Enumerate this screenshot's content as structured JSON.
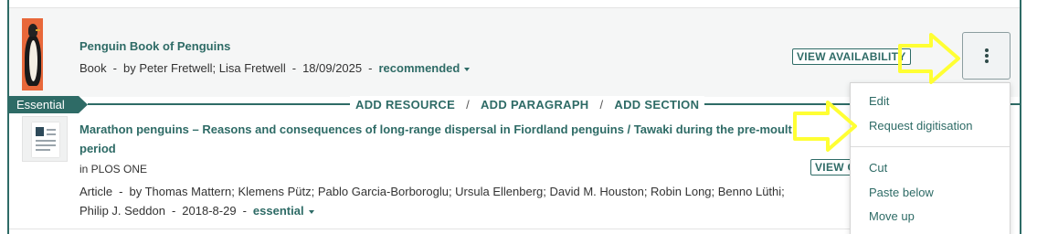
{
  "item1": {
    "title": "Penguin Book of Penguins",
    "type": "Book",
    "authors": "by Peter Fretwell; Lisa Fretwell",
    "date": "18/09/2025",
    "importance": "recommended",
    "availability_button": "VIEW AVAILABILITY",
    "cover_icon": "book-cover-penguin"
  },
  "section": {
    "flag": "Essential",
    "add_resource": "ADD RESOURCE",
    "add_paragraph": "ADD PARAGRAPH",
    "add_section": "ADD SECTION",
    "separator": "/"
  },
  "item2": {
    "title": "Marathon penguins – Reasons and consequences of long-range dispersal in Fiordland penguins / Tawaki during the pre-moult period",
    "source": "in PLOS ONE",
    "type": "Article",
    "authors": "by Thomas Mattern; Klemens Pütz; Pablo Garcia-Borboroglu; Ursula Ellenberg; David M. Houston; Robin Long; Benno Lüthi; Philip J. Seddon",
    "date": "2018-8-29",
    "importance": "essential",
    "availability_button": "VIEW C",
    "thumb_icon": "article-document-icon"
  },
  "separator_dash": "-",
  "menu": {
    "items": [
      "Edit",
      "Request digitisation",
      "Cut",
      "Paste below",
      "Move up"
    ]
  },
  "colors": {
    "accent": "#2e6b66",
    "highlight_arrow": "#ffff33"
  }
}
